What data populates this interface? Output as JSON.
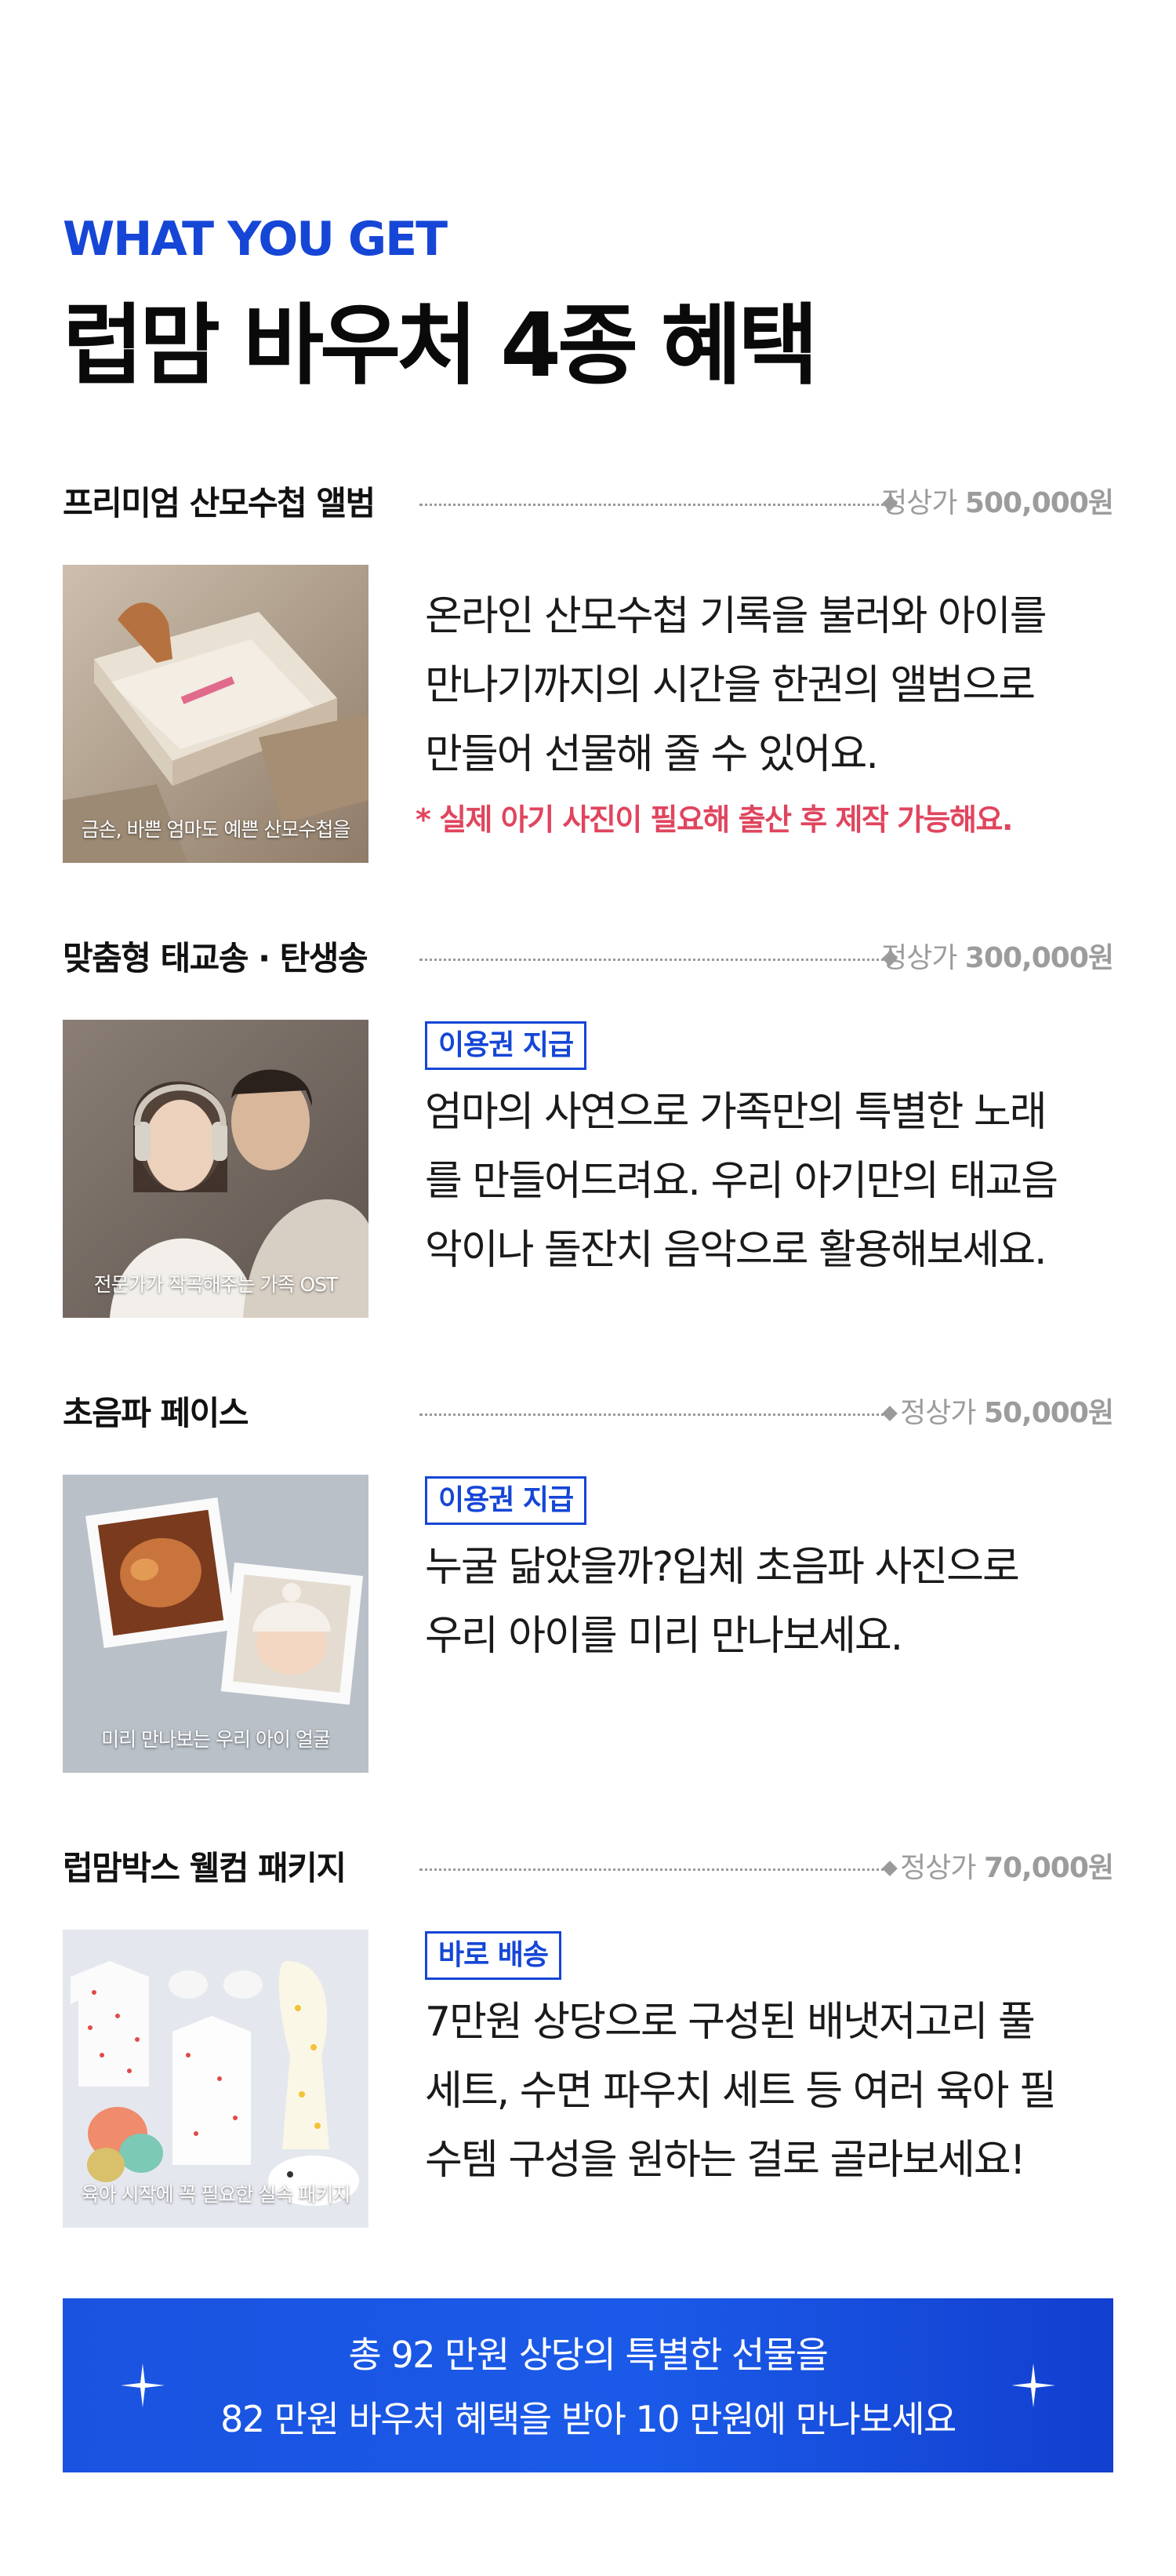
{
  "header": {
    "eyebrow": "WHAT YOU GET",
    "title": "럽맘 바우처 4종 혜택"
  },
  "sections": [
    {
      "name": "프리미엄 산모수첩 앨범",
      "price_label": "정상가",
      "price_value": "500,000원",
      "caption": "금손, 바쁜 엄마도 예쁜 산모수첩을",
      "tag": "",
      "description": [
        "온라인 산모수첩 기록을 불러와 아이를",
        "만나기까지의 시간을 한권의 앨범으로",
        "만들어 선물해 줄 수 있어요."
      ],
      "note": "* 실제 아기 사진이 필요해 출산 후 제작 가능해요."
    },
    {
      "name": "맞춤형 태교송 · 탄생송",
      "price_label": "정상가",
      "price_value": "300,000원",
      "caption": "전문가가 작곡해주는 가족 OST",
      "tag": "이용권 지급",
      "description": [
        "엄마의 사연으로 가족만의 특별한 노래",
        "를 만들어드려요. 우리 아기만의 태교음",
        "악이나 돌잔치 음악으로 활용해보세요."
      ]
    },
    {
      "name": "초음파 페이스",
      "price_label": "정상가",
      "price_value": "50,000원",
      "caption": "미리 만나보는 우리 아이 얼굴",
      "tag": "이용권 지급",
      "description": [
        "누굴 닮았을까?입체 초음파 사진으로",
        "우리 아이를 미리 만나보세요."
      ]
    },
    {
      "name": "럽맘박스 웰컴 패키지",
      "price_label": "정상가",
      "price_value": "70,000원",
      "caption": "육아 시작에 꼭 필요한 실속 패키지",
      "tag": "바로 배송",
      "description": [
        "7만원 상당으로 구성된 배냇저고리 풀",
        "세트, 수면 파우치 세트 등 여러 육아 필",
        "수템 구성을 원하는 걸로 골라보세요!"
      ]
    }
  ],
  "banner": {
    "line1": "총 92 만원 상당의 특별한 선물을",
    "line2": "82 만원 바우처 혜택을 받아 10 만원에 만나보세요"
  },
  "colors": {
    "accent": "#1546d6",
    "note": "#e0455e",
    "price": "#9c9c9c",
    "banner": "#1a53e0"
  }
}
